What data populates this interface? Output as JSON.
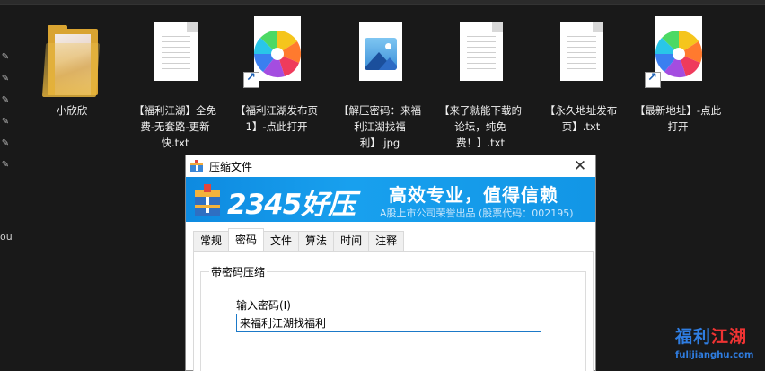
{
  "desktop": {
    "side_text": "ou",
    "files": [
      {
        "label": "小欣欣",
        "icon": "folder-icon"
      },
      {
        "label": "【福利江湖】全免费-无套路-更新快.txt",
        "icon": "text-file-icon"
      },
      {
        "label": "【福利江湖发布页1】-点此打开",
        "icon": "pinwheel-shortcut-icon"
      },
      {
        "label": "【解压密码：来福利江湖找福利】.jpg",
        "icon": "image-file-icon"
      },
      {
        "label": "【来了就能下载的论坛，纯免费！】.txt",
        "icon": "text-file-icon"
      },
      {
        "label": "【永久地址发布页】.txt",
        "icon": "text-file-icon"
      },
      {
        "label": "【最新地址】-点此打开",
        "icon": "pinwheel-shortcut-icon"
      }
    ]
  },
  "dialog": {
    "title": "压缩文件",
    "banner": {
      "brand": "2345好压",
      "slogan": "高效专业，值得信赖",
      "sub": "A股上市公司荣誉出品 (股票代码：002195)"
    },
    "tabs": [
      "常规",
      "密码",
      "文件",
      "算法",
      "时间",
      "注释"
    ],
    "active_tab": "密码",
    "group_label": "带密码压缩",
    "field_label": "输入密码(I)",
    "password_value": "来福利江湖找福利"
  },
  "watermark": {
    "title_a": "福利",
    "title_b": "江湖",
    "url": "fulijianghu.com"
  },
  "colors": {
    "desktop_bg": "#191919",
    "banner_blue": "#1296e6",
    "input_border": "#1b79c8",
    "folder": "#d9a431"
  }
}
